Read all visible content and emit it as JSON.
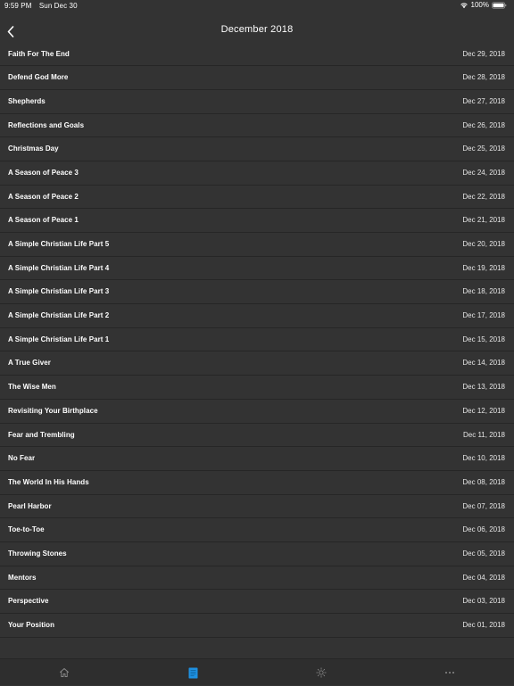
{
  "status_bar": {
    "time": "9:59 PM",
    "date": "Sun Dec 30",
    "battery": "100%"
  },
  "nav": {
    "title": "December 2018",
    "back_icon": "chevron-left-icon"
  },
  "entries": [
    {
      "title": "Faith For The End",
      "date": "Dec 29, 2018"
    },
    {
      "title": "Defend God More",
      "date": "Dec 28, 2018"
    },
    {
      "title": "Shepherds",
      "date": "Dec 27, 2018"
    },
    {
      "title": "Reflections and Goals",
      "date": "Dec 26, 2018"
    },
    {
      "title": "Christmas Day",
      "date": "Dec 25, 2018"
    },
    {
      "title": "A Season of Peace 3",
      "date": "Dec 24, 2018"
    },
    {
      "title": "A Season of Peace 2",
      "date": "Dec 22, 2018"
    },
    {
      "title": "A Season of Peace 1",
      "date": "Dec 21, 2018"
    },
    {
      "title": "A Simple Christian Life Part 5",
      "date": "Dec 20, 2018"
    },
    {
      "title": "A Simple Christian Life Part 4",
      "date": "Dec 19, 2018"
    },
    {
      "title": "A Simple Christian Life Part 3",
      "date": "Dec 18, 2018"
    },
    {
      "title": "A Simple Christian Life Part 2",
      "date": "Dec 17, 2018"
    },
    {
      "title": "A Simple Christian Life Part 1",
      "date": "Dec 15, 2018"
    },
    {
      "title": "A True Giver",
      "date": "Dec 14, 2018"
    },
    {
      "title": "The Wise Men",
      "date": "Dec 13, 2018"
    },
    {
      "title": "Revisiting Your Birthplace",
      "date": "Dec 12, 2018"
    },
    {
      "title": "Fear and Trembling",
      "date": "Dec 11, 2018"
    },
    {
      "title": "No Fear",
      "date": "Dec 10, 2018"
    },
    {
      "title": "The World In His Hands",
      "date": "Dec 08, 2018"
    },
    {
      "title": "Pearl Harbor",
      "date": "Dec 07, 2018"
    },
    {
      "title": "Toe-to-Toe",
      "date": "Dec 06, 2018"
    },
    {
      "title": "Throwing Stones",
      "date": "Dec 05, 2018"
    },
    {
      "title": "Mentors",
      "date": "Dec 04, 2018"
    },
    {
      "title": "Perspective",
      "date": "Dec 03, 2018"
    },
    {
      "title": "Your Position",
      "date": "Dec 01, 2018"
    }
  ],
  "tab_bar": {
    "tabs": [
      {
        "icon": "home-icon",
        "active": false
      },
      {
        "icon": "book-icon",
        "active": true
      },
      {
        "icon": "brightness-icon",
        "active": false
      },
      {
        "icon": "more-icon",
        "active": false
      }
    ]
  },
  "colors": {
    "background": "#333333",
    "divider": "#262626",
    "tab_bar": "#2e2e2e",
    "text": "#ffffff",
    "inactive_icon": "#8a8a8a",
    "accent": "#1e90e0"
  }
}
